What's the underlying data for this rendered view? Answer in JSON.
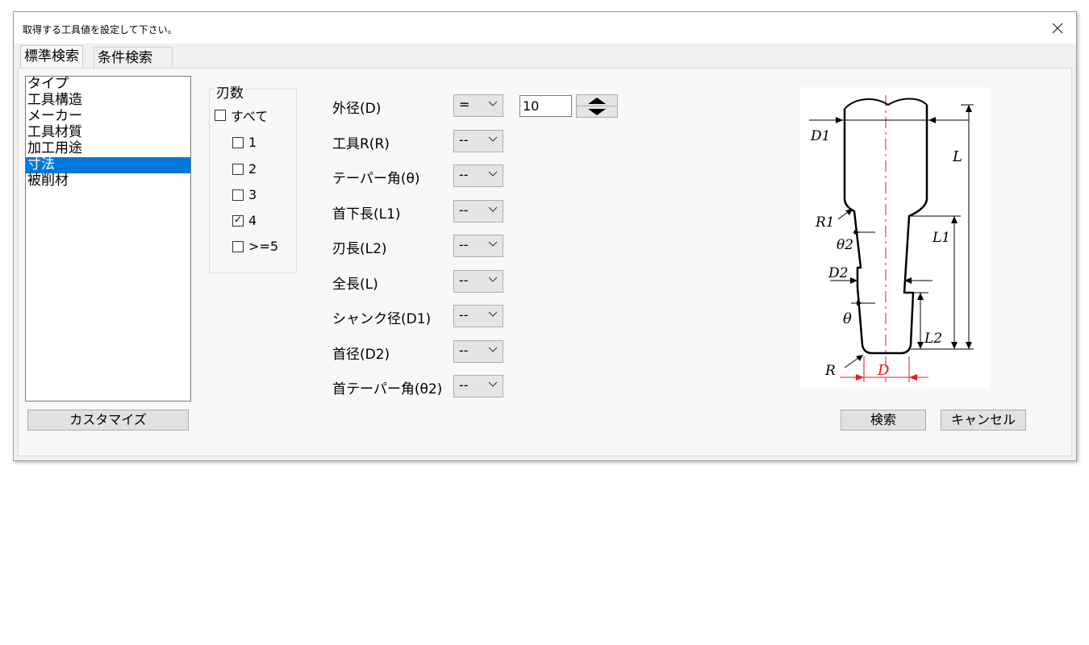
{
  "window": {
    "title": "取得する工具値を設定して下さい。",
    "close_icon": "close-icon"
  },
  "tabs": [
    {
      "label": "標準検索",
      "active": true
    },
    {
      "label": "条件検索",
      "active": false
    }
  ],
  "category_list": {
    "items": [
      "タイプ",
      "工具構造",
      "メーカー",
      "工具材質",
      "加工用途",
      "寸法",
      "被削材"
    ],
    "selected": "寸法"
  },
  "customize_button": "カスタマイズ",
  "flutes": {
    "title": "刃数",
    "options": [
      {
        "label": "すべて",
        "checked": false
      },
      {
        "label": "1",
        "checked": false
      },
      {
        "label": "2",
        "checked": false
      },
      {
        "label": "3",
        "checked": false
      },
      {
        "label": "4",
        "checked": true
      },
      {
        "label": ">=5",
        "checked": false
      }
    ]
  },
  "dimensions": [
    {
      "label": "外径(D)",
      "operator": "="
    },
    {
      "label": "工具R(R)",
      "operator": "--"
    },
    {
      "label": "テーパー角(θ)",
      "operator": "--"
    },
    {
      "label": "首下長(L1)",
      "operator": "--"
    },
    {
      "label": "刃長(L2)",
      "operator": "--"
    },
    {
      "label": "全長(L)",
      "operator": "--"
    },
    {
      "label": "シャンク径(D1)",
      "operator": "--"
    },
    {
      "label": "首径(D2)",
      "operator": "--"
    },
    {
      "label": "首テーパー角(θ2)",
      "operator": "--"
    }
  ],
  "diameter_value": "10",
  "diagram_labels": {
    "d1": "D1",
    "l": "L",
    "r1": "R1",
    "theta2": "θ2",
    "l1": "L1",
    "d2": "D2",
    "theta": "θ",
    "l2": "L2",
    "r": "R",
    "d": "D"
  },
  "search_button": "検索",
  "cancel_button": "キャンセル",
  "colors": {
    "selection": "#0078d7",
    "diagram_red": "#e8191c"
  }
}
